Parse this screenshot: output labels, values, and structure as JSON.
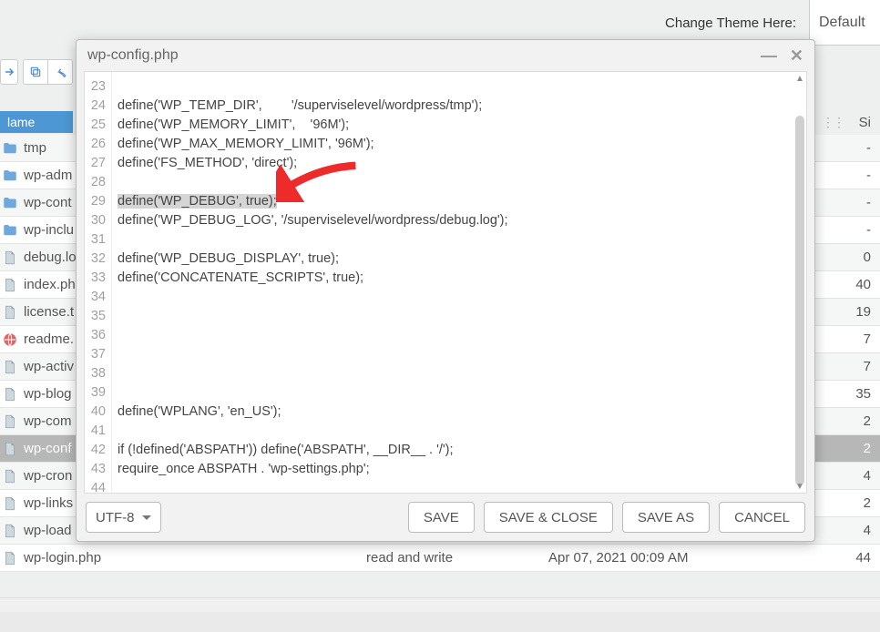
{
  "topbar": {
    "label": "Change Theme Here:",
    "theme": "Default"
  },
  "columns": {
    "name": "lame",
    "size": "Si"
  },
  "files": [
    {
      "icon": "folder",
      "name": "tmp",
      "perm": "",
      "date": "",
      "size": "-"
    },
    {
      "icon": "folder",
      "name": "wp-adm",
      "perm": "",
      "date": "",
      "size": "-"
    },
    {
      "icon": "folder",
      "name": "wp-cont",
      "perm": "",
      "date": "",
      "size": "-"
    },
    {
      "icon": "folder",
      "name": "wp-inclu",
      "perm": "",
      "date": "",
      "size": "-"
    },
    {
      "icon": "file",
      "name": "debug.lo",
      "perm": "",
      "date": "",
      "size": "0 "
    },
    {
      "icon": "file",
      "name": "index.ph",
      "perm": "",
      "date": "",
      "size": "40"
    },
    {
      "icon": "file",
      "name": "license.t",
      "perm": "",
      "date": "",
      "size": "19"
    },
    {
      "icon": "html",
      "name": "readme.",
      "perm": "",
      "date": "",
      "size": "7 "
    },
    {
      "icon": "file",
      "name": "wp-activ",
      "perm": "",
      "date": "",
      "size": "7 "
    },
    {
      "icon": "file",
      "name": "wp-blog",
      "perm": "",
      "date": "",
      "size": "35"
    },
    {
      "icon": "file",
      "name": "wp-com",
      "perm": "",
      "date": "",
      "size": "2 "
    },
    {
      "icon": "file",
      "name": "wp-conf",
      "perm": "",
      "date": "",
      "size": "2 ",
      "selected": true
    },
    {
      "icon": "file",
      "name": "wp-cron",
      "perm": "",
      "date": "",
      "size": "4 "
    },
    {
      "icon": "file",
      "name": "wp-links",
      "perm": "",
      "date": "",
      "size": "2 "
    },
    {
      "icon": "file",
      "name": "wp-load",
      "perm": "",
      "date": "",
      "size": "4 "
    },
    {
      "icon": "file",
      "name": "wp-login.php",
      "perm": "read and write",
      "date": "Apr 07, 2021 00:09 AM",
      "size": "44"
    }
  ],
  "editor": {
    "title": "wp-config.php",
    "encoding": "UTF-8",
    "first_line_no": 23,
    "highlight_line": 29,
    "lines": [
      "",
      "define('WP_TEMP_DIR',        '/superviselevel/wordpress/tmp');",
      "define('WP_MEMORY_LIMIT',    '96M');",
      "define('WP_MAX_MEMORY_LIMIT', '96M');",
      "define('FS_METHOD', 'direct');",
      "",
      "define('WP_DEBUG', true);",
      "define('WP_DEBUG_LOG', '/superviselevel/wordpress/debug.log');",
      "",
      "define('WP_DEBUG_DISPLAY', true);",
      "define('CONCATENATE_SCRIPTS', true);",
      "",
      "",
      "",
      "",
      "",
      "",
      "define('WPLANG', 'en_US');",
      "",
      "if (!defined('ABSPATH')) define('ABSPATH', __DIR__ . '/');",
      "require_once ABSPATH . 'wp-settings.php';",
      ""
    ],
    "buttons": {
      "save": "SAVE",
      "save_close": "SAVE & CLOSE",
      "save_as": "SAVE AS",
      "cancel": "CANCEL"
    }
  }
}
